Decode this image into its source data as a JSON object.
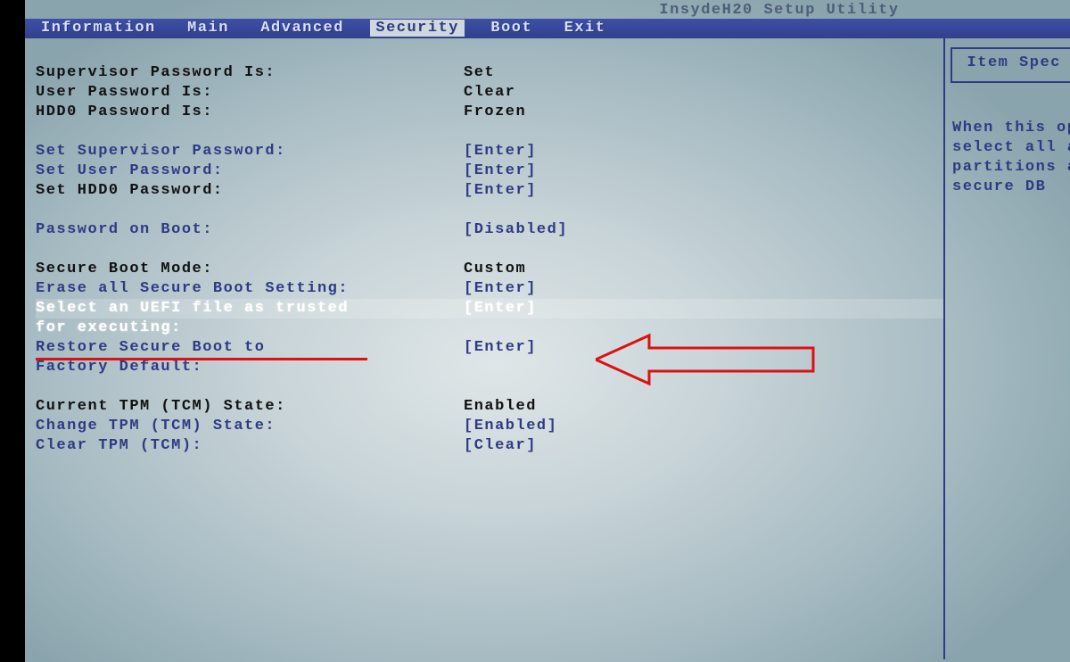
{
  "title": "InsydeH20 Setup Utility",
  "menu": {
    "items": [
      "Information",
      "Main",
      "Advanced",
      "Security",
      "Boot",
      "Exit"
    ],
    "active_index": 3
  },
  "help": {
    "header": "Item Spec",
    "body": "When this op\nselect all a\npartitions a\nsecure DB"
  },
  "rows": [
    {
      "label": "Supervisor Password Is:",
      "value": "Set",
      "label_color": "black",
      "value_color": "black"
    },
    {
      "label": "User Password Is:",
      "value": "Clear",
      "label_color": "black",
      "value_color": "black"
    },
    {
      "label": "HDD0 Password Is:",
      "value": "Frozen",
      "label_color": "black",
      "value_color": "black"
    },
    {
      "gap": true
    },
    {
      "label": "Set Supervisor Password:",
      "value": "[Enter]",
      "label_color": "blue",
      "value_color": "blue",
      "interact": true
    },
    {
      "label": "Set User Password:",
      "value": "[Enter]",
      "label_color": "blue",
      "value_color": "blue",
      "interact": true
    },
    {
      "label": "Set HDD0 Password:",
      "value": "[Enter]",
      "label_color": "black",
      "value_color": "blue",
      "interact": true
    },
    {
      "gap": true
    },
    {
      "label": "Password on Boot:",
      "value": "[Disabled]",
      "label_color": "blue",
      "value_color": "blue",
      "interact": true
    },
    {
      "gap": true
    },
    {
      "label": "Secure Boot Mode:",
      "value": "Custom",
      "label_color": "black",
      "value_color": "black"
    },
    {
      "label": "Erase all Secure Boot Setting:",
      "value": "[Enter]",
      "label_color": "blue",
      "value_color": "blue",
      "interact": true
    },
    {
      "label": "Select an UEFI file as trusted",
      "value": "[Enter]",
      "label_color": "white",
      "value_color": "white",
      "selected": true,
      "interact": true
    },
    {
      "label": "for executing:",
      "value": "",
      "label_color": "white",
      "value_color": "white"
    },
    {
      "label": "Restore Secure Boot to",
      "value": "[Enter]",
      "label_color": "blue",
      "value_color": "blue",
      "interact": true
    },
    {
      "label": "Factory Default:",
      "value": "",
      "label_color": "blue",
      "value_color": "blue"
    },
    {
      "gap": true
    },
    {
      "label": "Current TPM (TCM) State:",
      "value": "Enabled",
      "label_color": "black",
      "value_color": "black"
    },
    {
      "label": "Change TPM (TCM) State:",
      "value": "[Enabled]",
      "label_color": "blue",
      "value_color": "blue",
      "interact": true
    },
    {
      "label": "Clear TPM (TCM):",
      "value": "[Clear]",
      "label_color": "blue",
      "value_color": "blue",
      "interact": true
    }
  ]
}
